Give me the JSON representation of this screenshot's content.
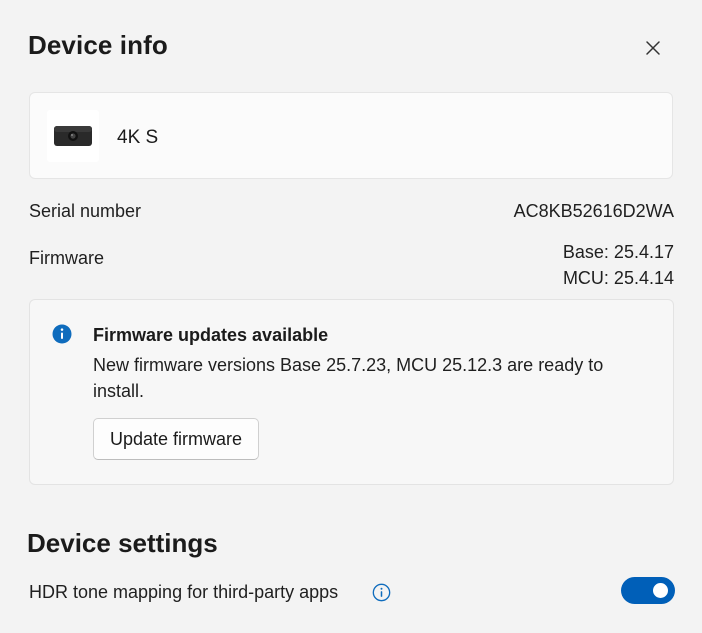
{
  "panel": {
    "title": "Device info",
    "close_icon": "close-icon"
  },
  "device": {
    "name": "4K S",
    "icon": "webcam-icon"
  },
  "info_rows": {
    "serial_label": "Serial number",
    "serial_value": "AC8KB52616D2WA",
    "firmware_label": "Firmware",
    "firmware_base": "Base: 25.4.17",
    "firmware_mcu": "MCU: 25.4.14"
  },
  "update_notice": {
    "icon": "info-icon",
    "title": "Firmware updates available",
    "message": "New firmware versions Base 25.7.23, MCU 25.12.3 are ready to install.",
    "button_label": "Update firmware"
  },
  "device_settings": {
    "title": "Device settings",
    "hdr_label": "HDR tone mapping for third-party apps",
    "hdr_info_icon": "info-outline-icon",
    "hdr_enabled": true
  },
  "colors": {
    "accent": "#005fb8",
    "background": "#f3f3f3",
    "card": "#fbfbfb"
  }
}
